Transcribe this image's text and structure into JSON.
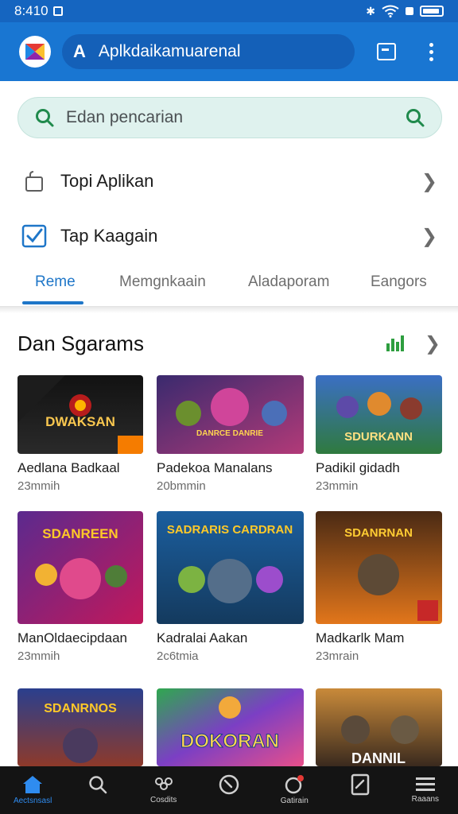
{
  "status_bar": {
    "time": "8:410",
    "icons": [
      "notification-icon",
      "bluetooth-icon",
      "wifi-icon",
      "sim-icon",
      "battery-icon"
    ]
  },
  "app_bar": {
    "url_prefix": "A",
    "url_text": "Aplkdaikamuarenal",
    "icons": [
      "app-logo-icon",
      "tabs-icon",
      "more-vert-icon"
    ]
  },
  "search": {
    "placeholder": "Edan pencarian",
    "icons": [
      "search-icon",
      "search-submit-icon"
    ]
  },
  "menu": [
    {
      "label": "Topi Aplikan",
      "icon": "bag-outline-icon"
    },
    {
      "label": "Tap Kaagain",
      "icon": "checkbox-icon"
    }
  ],
  "tabs": [
    {
      "label": "Reme",
      "active": true
    },
    {
      "label": "Memgnkaain",
      "active": false
    },
    {
      "label": "Aladaporam",
      "active": false
    },
    {
      "label": "Eangors",
      "active": false
    }
  ],
  "section": {
    "title": "Dan Sgarams",
    "icons": [
      "chart-icon",
      "chevron-right-icon"
    ]
  },
  "cards": [
    {
      "title": "Aedlana Badkaal",
      "sub": "23mmih",
      "thumb_text": "DWAKSAN"
    },
    {
      "title": "Padekoa Manalans",
      "sub": "20bmmin",
      "thumb_text": "DANRCE DANRIE"
    },
    {
      "title": "Padikil gidadh",
      "sub": "23mmin",
      "thumb_text": "SDURKANN"
    },
    {
      "title": "ManOldaecipdaan",
      "sub": "23mmih",
      "thumb_text": "SDANREEN"
    },
    {
      "title": "Kadralai Aakan",
      "sub": "2c6tmia",
      "thumb_text": "SADRARIS CARDRAN"
    },
    {
      "title": "Madkarlk Mam",
      "sub": "23mrain",
      "thumb_text": "SDANRNAN"
    },
    {
      "title": "",
      "sub": "",
      "thumb_text": "SDANRNOS"
    },
    {
      "title": "",
      "sub": "",
      "thumb_text": "DOKORAN"
    },
    {
      "title": "",
      "sub": "",
      "thumb_text": "DANNIL"
    }
  ],
  "bottom_nav": [
    {
      "label": "Aectsnsasl",
      "icon": "home-icon",
      "active": true
    },
    {
      "label": "",
      "icon": "search-icon",
      "active": false
    },
    {
      "label": "Cosdits",
      "icon": "people-icon",
      "active": false
    },
    {
      "label": "",
      "icon": "compass-icon",
      "active": false
    },
    {
      "label": "Gatirain",
      "icon": "notifications-icon",
      "active": false
    },
    {
      "label": "",
      "icon": "edit-note-icon",
      "active": false
    },
    {
      "label": "Raaans",
      "icon": "menu-icon",
      "active": false
    }
  ],
  "colors": {
    "status_bar": "#1565c0",
    "app_bar": "#1976d2",
    "accent": "#1e76c8",
    "search_bg": "#dff2ee",
    "search_icon": "#1f8a4c",
    "bottom_nav": "#141414"
  }
}
